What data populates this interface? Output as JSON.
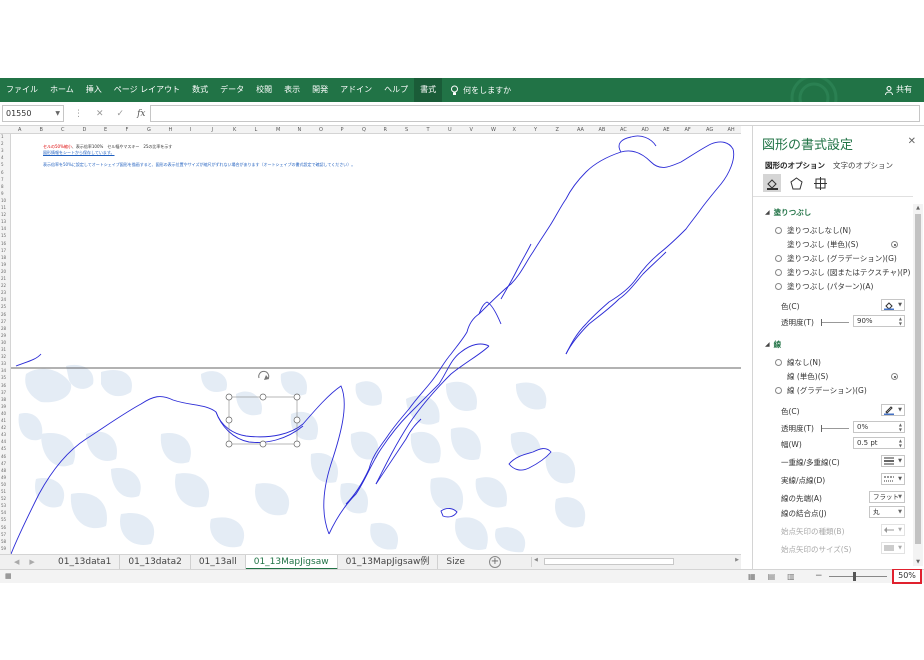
{
  "ribbon": {
    "tabs": [
      "ファイル",
      "ホーム",
      "挿入",
      "ページ レイアウト",
      "数式",
      "データ",
      "校閲",
      "表示",
      "開発",
      "アドイン",
      "ヘルプ",
      "書式"
    ],
    "active_tab": "書式",
    "tell_me": "何をしますか",
    "share": "共有"
  },
  "formula_bar": {
    "name_box": "01550",
    "fx": "fx",
    "value": ""
  },
  "columns": [
    "A",
    "B",
    "C",
    "D",
    "E",
    "F",
    "G",
    "H",
    "I",
    "J",
    "K",
    "L",
    "M",
    "N",
    "O",
    "P",
    "Q",
    "R",
    "S",
    "T",
    "U",
    "V",
    "W",
    "X",
    "Y",
    "Z",
    "AA",
    "AB",
    "AC",
    "AD",
    "AE",
    "AF",
    "AG",
    "AH"
  ],
  "rows": [
    "1",
    "2",
    "3",
    "4",
    "5",
    "6",
    "7",
    "8",
    "9",
    "10",
    "11",
    "12",
    "13",
    "14",
    "15",
    "16",
    "17",
    "18",
    "19",
    "20",
    "21",
    "22",
    "23",
    "24",
    "25",
    "26",
    "27",
    "28",
    "29",
    "30",
    "31",
    "32",
    "33",
    "34",
    "35",
    "36",
    "37",
    "38",
    "39",
    "40",
    "41",
    "42",
    "43",
    "44",
    "45",
    "46",
    "47",
    "48",
    "49",
    "50",
    "51",
    "52",
    "53",
    "54",
    "55",
    "56",
    "57",
    "58",
    "59"
  ],
  "sheet_notes": {
    "line1_red": "セルの50%縮小",
    "line1_rest": "、表示倍率100%　セル幅やマスキー　25の比率を示す",
    "line2": "図形情報をシートから保存しています。",
    "line3": "表示倍率を50%に設定してオートシェイプ図形を描画すると、図形の表示位置やサイズが縮尺がずれない場合があります（オートシェイプの書式設定で確認してください）。"
  },
  "sheet_tabs": [
    "01_13data1",
    "01_13data2",
    "01_13all",
    "01_13MapJigsaw",
    "01_13MapJigsaw例",
    "Size"
  ],
  "active_sheet": "01_13MapJigsaw",
  "status": {
    "zoom": "50%",
    "minus": "−",
    "plus": "+"
  },
  "pane": {
    "title": "図形の書式設定",
    "tab_shape": "図形のオプション",
    "tab_text": "文字のオプション",
    "fill": {
      "header": "塗りつぶし",
      "options": [
        "塗りつぶしなし(N)",
        "塗りつぶし (単色)(S)",
        "塗りつぶし (グラデーション)(G)",
        "塗りつぶし (図またはテクスチャ)(P)",
        "塗りつぶし (パターン)(A)"
      ],
      "selected_index": 1,
      "color_label": "色(C)",
      "transparency_label": "透明度(T)",
      "transparency_value": "90%"
    },
    "line": {
      "header": "線",
      "options": [
        "線なし(N)",
        "線 (単色)(S)",
        "線 (グラデーション)(G)"
      ],
      "selected_index": 1,
      "color_label": "色(C)",
      "transparency_label": "透明度(T)",
      "transparency_value": "0%",
      "width_label": "幅(W)",
      "width_value": "0.5 pt",
      "compound_label": "一重線/多重線(C)",
      "dash_label": "実線/点線(D)",
      "cap_label": "線の先端(A)",
      "cap_value": "フラット",
      "join_label": "線の結合点(J)",
      "join_value": "丸",
      "begin_arrow_type": "始点矢印の種類(B)",
      "begin_arrow_size": "始点矢印のサイズ(S)"
    },
    "colors": {
      "fill_accent": "#4472c4",
      "line_accent": "#4472c4"
    }
  },
  "colors": {
    "ribbon": "#217346",
    "map_outline": "#2b2bd6",
    "map_fill": "#e4ecf5",
    "zoom_highlight": "#e0212e"
  }
}
